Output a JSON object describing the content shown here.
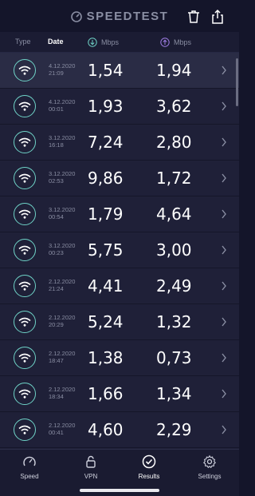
{
  "header": {
    "title": "SPEEDTEST",
    "trash_icon": "trash-icon",
    "share_icon": "share-icon"
  },
  "columns": {
    "type": "Type",
    "date": "Date",
    "download": "Mbps",
    "upload": "Mbps"
  },
  "colors": {
    "accent_teal": "#6fd3c7",
    "accent_purple": "#a07ee6",
    "background": "#151629"
  },
  "results": [
    {
      "date": "4.12.2020",
      "time": "21:09",
      "download": "1,54",
      "upload": "1,94"
    },
    {
      "date": "4.12.2020",
      "time": "00:01",
      "download": "1,93",
      "upload": "3,62"
    },
    {
      "date": "3.12.2020",
      "time": "16:18",
      "download": "7,24",
      "upload": "2,80"
    },
    {
      "date": "3.12.2020",
      "time": "02:53",
      "download": "9,86",
      "upload": "1,72"
    },
    {
      "date": "3.12.2020",
      "time": "00:54",
      "download": "1,79",
      "upload": "4,64"
    },
    {
      "date": "3.12.2020",
      "time": "00:23",
      "download": "5,75",
      "upload": "3,00"
    },
    {
      "date": "2.12.2020",
      "time": "21:24",
      "download": "4,41",
      "upload": "2,49"
    },
    {
      "date": "2.12.2020",
      "time": "20:29",
      "download": "5,24",
      "upload": "1,32"
    },
    {
      "date": "2.12.2020",
      "time": "18:47",
      "download": "1,38",
      "upload": "0,73"
    },
    {
      "date": "2.12.2020",
      "time": "18:34",
      "download": "1,66",
      "upload": "1,34"
    },
    {
      "date": "2.12.2020",
      "time": "00:41",
      "download": "4,60",
      "upload": "2,29"
    },
    {
      "date": "",
      "time": "",
      "download": "",
      "upload": ""
    }
  ],
  "tabs": [
    {
      "label": "Speed",
      "icon": "speedometer-icon"
    },
    {
      "label": "VPN",
      "icon": "lock-icon"
    },
    {
      "label": "Results",
      "icon": "checkmark-circle-icon",
      "active": true
    },
    {
      "label": "Settings",
      "icon": "gear-icon"
    }
  ]
}
